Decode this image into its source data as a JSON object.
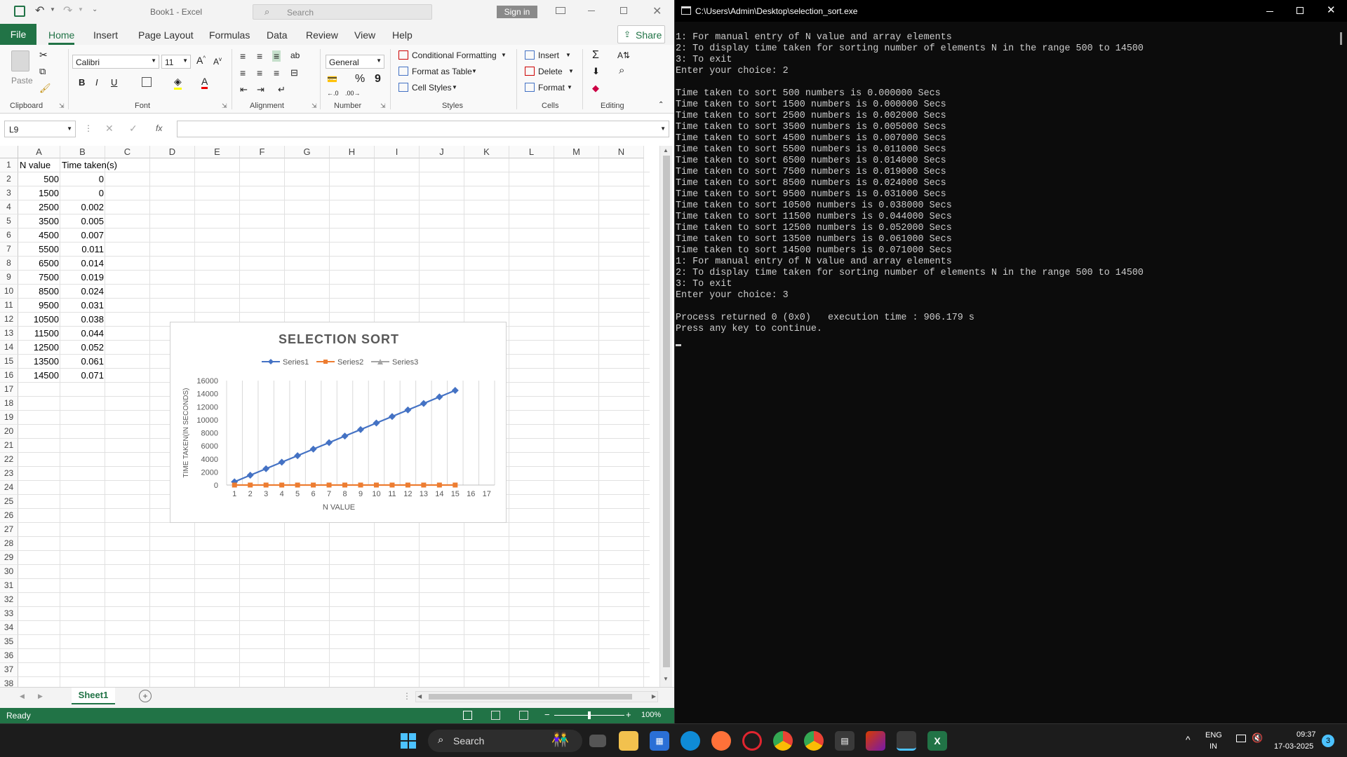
{
  "excel": {
    "title": "Book1  -  Excel",
    "search_placeholder": "Search",
    "sign_in": "Sign in",
    "tabs": [
      "File",
      "Home",
      "Insert",
      "Page Layout",
      "Formulas",
      "Data",
      "Review",
      "View",
      "Help"
    ],
    "share": "Share",
    "ribbon": {
      "paste": "Paste",
      "font_name": "Calibri",
      "font_size": "11",
      "number_format": "General",
      "conditional_formatting": "Conditional Formatting",
      "format_as_table": "Format as Table",
      "cell_styles": "Cell Styles",
      "insert": "Insert",
      "delete": "Delete",
      "format": "Format",
      "groups": [
        "Clipboard",
        "Font",
        "Alignment",
        "Number",
        "Styles",
        "Cells",
        "Editing"
      ]
    },
    "name_box": "L9",
    "fx": "fx",
    "columns": [
      "A",
      "B",
      "C",
      "D",
      "E",
      "F",
      "G",
      "H",
      "I",
      "J",
      "K",
      "L",
      "M",
      "N"
    ],
    "rows": [
      "1",
      "2",
      "3",
      "4",
      "5",
      "6",
      "7",
      "8",
      "9",
      "10",
      "11",
      "12",
      "13",
      "14",
      "15",
      "16",
      "17",
      "18",
      "19",
      "20",
      "21",
      "22",
      "23",
      "24",
      "25",
      "26",
      "27",
      "28",
      "29",
      "30",
      "31",
      "32",
      "33",
      "34",
      "35",
      "36",
      "37",
      "38"
    ],
    "header_a": "N value",
    "header_b": "Time taken(s)",
    "col_a": [
      "500",
      "1500",
      "2500",
      "3500",
      "4500",
      "5500",
      "6500",
      "7500",
      "8500",
      "9500",
      "10500",
      "11500",
      "12500",
      "13500",
      "14500"
    ],
    "col_b": [
      "0",
      "0",
      "0.002",
      "0.005",
      "0.007",
      "0.011",
      "0.014",
      "0.019",
      "0.024",
      "0.031",
      "0.038",
      "0.044",
      "0.052",
      "0.061",
      "0.071"
    ],
    "sheet_tab": "Sheet1",
    "status": "Ready",
    "zoom": "100%"
  },
  "chart_data": {
    "type": "line",
    "title": "SELECTION SORT",
    "xlabel": "N VALUE",
    "ylabel": "TIME TAKEN(IN SECONDS)",
    "categories": [
      "1",
      "2",
      "3",
      "4",
      "5",
      "6",
      "7",
      "8",
      "9",
      "10",
      "11",
      "12",
      "13",
      "14",
      "15",
      "16",
      "17"
    ],
    "yticks": [
      "0",
      "2000",
      "4000",
      "6000",
      "8000",
      "10000",
      "12000",
      "14000",
      "16000"
    ],
    "ylim": [
      0,
      16000
    ],
    "legend_position": "top",
    "series": [
      {
        "name": "Series1",
        "color": "#4472c4",
        "marker": "diamond",
        "values": [
          500,
          1500,
          2500,
          3500,
          4500,
          5500,
          6500,
          7500,
          8500,
          9500,
          10500,
          11500,
          12500,
          13500,
          14500
        ]
      },
      {
        "name": "Series2",
        "color": "#ed7d31",
        "marker": "square",
        "values": [
          0,
          0,
          0.002,
          0.005,
          0.007,
          0.011,
          0.014,
          0.019,
          0.024,
          0.031,
          0.038,
          0.044,
          0.052,
          0.061,
          0.071
        ]
      },
      {
        "name": "Series3",
        "color": "#a5a5a5",
        "marker": "triangle",
        "values": []
      }
    ]
  },
  "console": {
    "title": "C:\\Users\\Admin\\Desktop\\selection_sort.exe",
    "lines": [
      "1: For manual entry of N value and array elements",
      "2: To display time taken for sorting number of elements N in the range 500 to 14500",
      "3: To exit",
      "Enter your choice: 2",
      "",
      "Time taken to sort 500 numbers is 0.000000 Secs",
      "Time taken to sort 1500 numbers is 0.000000 Secs",
      "Time taken to sort 2500 numbers is 0.002000 Secs",
      "Time taken to sort 3500 numbers is 0.005000 Secs",
      "Time taken to sort 4500 numbers is 0.007000 Secs",
      "Time taken to sort 5500 numbers is 0.011000 Secs",
      "Time taken to sort 6500 numbers is 0.014000 Secs",
      "Time taken to sort 7500 numbers is 0.019000 Secs",
      "Time taken to sort 8500 numbers is 0.024000 Secs",
      "Time taken to sort 9500 numbers is 0.031000 Secs",
      "Time taken to sort 10500 numbers is 0.038000 Secs",
      "Time taken to sort 11500 numbers is 0.044000 Secs",
      "Time taken to sort 12500 numbers is 0.052000 Secs",
      "Time taken to sort 13500 numbers is 0.061000 Secs",
      "Time taken to sort 14500 numbers is 0.071000 Secs",
      "1: For manual entry of N value and array elements",
      "2: To display time taken for sorting number of elements N in the range 500 to 14500",
      "3: To exit",
      "Enter your choice: 3",
      "",
      "Process returned 0 (0x0)   execution time : 906.179 s",
      "Press any key to continue."
    ]
  },
  "taskbar": {
    "search": "Search",
    "lang_top": "ENG",
    "lang_bottom": "IN",
    "time": "09:37",
    "date": "17-03-2025",
    "notifications": "3"
  }
}
